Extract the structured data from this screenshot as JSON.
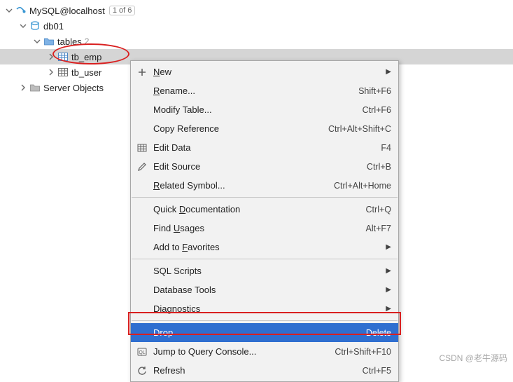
{
  "tree": {
    "root": {
      "label": "MySQL@localhost",
      "tag": "1 of 6"
    },
    "db": {
      "label": "db01"
    },
    "tables": {
      "label": "tables",
      "count": "2"
    },
    "tb_emp": {
      "label": "tb_emp"
    },
    "tb_user": {
      "label": "tb_user"
    },
    "server_objects": {
      "label": "Server Objects"
    }
  },
  "menu": {
    "new": {
      "label": "New",
      "mn": "N"
    },
    "rename": {
      "label": "Rename...",
      "mn": "R",
      "sc": "Shift+F6"
    },
    "modify": {
      "label": "Modify Table...",
      "sc": "Ctrl+F6"
    },
    "copyref": {
      "label": "Copy Reference",
      "sc": "Ctrl+Alt+Shift+C"
    },
    "editdata": {
      "label": "Edit Data",
      "sc": "F4"
    },
    "editsource": {
      "label": "Edit Source",
      "sc": "Ctrl+B"
    },
    "related": {
      "label": "Related Symbol...",
      "mn": "R",
      "sc": "Ctrl+Alt+Home"
    },
    "quickdoc": {
      "label": "Quick Documentation",
      "mn": "D",
      "sc": "Ctrl+Q"
    },
    "findusages": {
      "label": "Find Usages",
      "mn": "U",
      "sc": "Alt+F7"
    },
    "addfav": {
      "label": "Add to Favorites",
      "mn": "F"
    },
    "sqlscripts": {
      "label": "SQL Scripts"
    },
    "dbtools": {
      "label": "Database Tools"
    },
    "diagnostics": {
      "label": "Diagnostics",
      "mn": "s"
    },
    "drop": {
      "label": "Drop",
      "sc": "Delete"
    },
    "jump": {
      "label": "Jump to Query Console...",
      "sc": "Ctrl+Shift+F10"
    },
    "refresh": {
      "label": "Refresh",
      "sc": "Ctrl+F5"
    }
  },
  "watermark": "CSDN @老牛源码"
}
